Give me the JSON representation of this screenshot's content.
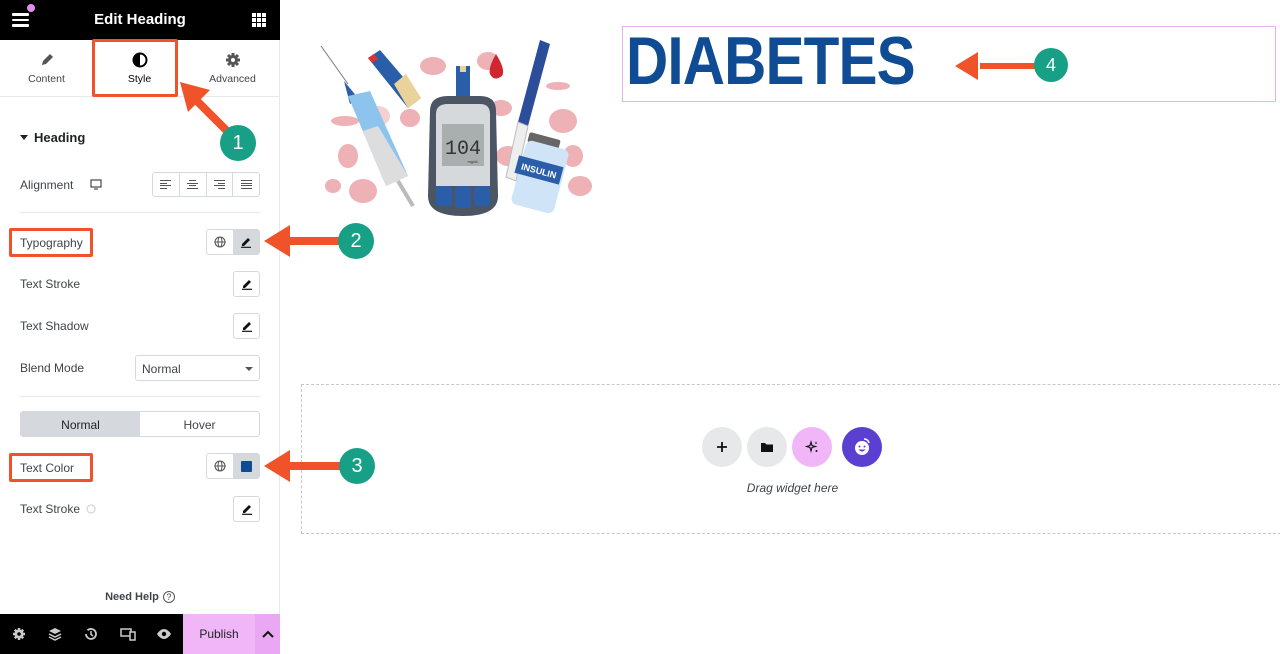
{
  "panel": {
    "title": "Edit Heading",
    "tabs": [
      {
        "label": "Content",
        "icon": "pencil-icon"
      },
      {
        "label": "Style",
        "icon": "half-circle-icon",
        "active": true
      },
      {
        "label": "Advanced",
        "icon": "gear-icon"
      }
    ],
    "section_title": "Heading",
    "alignment_label": "Alignment",
    "typography_label": "Typography",
    "text_stroke_label": "Text Stroke",
    "text_shadow_label": "Text Shadow",
    "blend_mode_label": "Blend Mode",
    "blend_mode_value": "Normal",
    "state_tabs": [
      "Normal",
      "Hover"
    ],
    "active_state": "Normal",
    "text_color_label": "Text Color",
    "text_color_value": "#0f4c93",
    "text_stroke2_label": "Text Stroke",
    "need_help": "Need Help",
    "publish": "Publish"
  },
  "canvas": {
    "heading": "DIABETES",
    "heading_color": "#0f4c93",
    "image_alt": "diabetes illustration: glucose meter reading 104 mg/dL, syringe, insulin pen, insulin vial, test strip, blood drop",
    "meter_reading": "104",
    "meter_unit": "mg/dL",
    "vial_label": "INSULIN",
    "dropzone_label": "Drag widget here"
  },
  "annotations": [
    {
      "number": "1",
      "target": "Style tab"
    },
    {
      "number": "2",
      "target": "Typography"
    },
    {
      "number": "3",
      "target": "Text Color"
    },
    {
      "number": "4",
      "target": "DIABETES heading"
    }
  ],
  "colors": {
    "accent": "#f0522a",
    "badge": "#17a085",
    "publish": "#f0b6f8",
    "heading": "#0f4c93"
  }
}
